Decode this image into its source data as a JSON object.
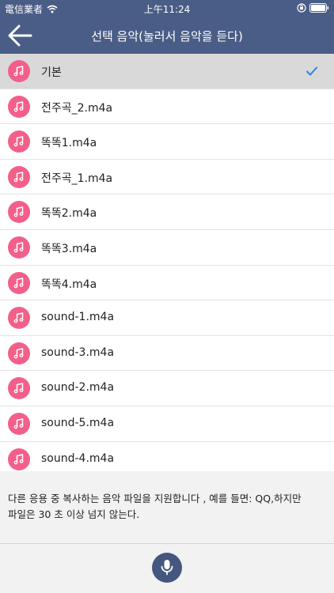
{
  "status_bar": {
    "carrier": "電信業者",
    "time": "上午11:24"
  },
  "nav": {
    "title": "선택 음악(눌러서 음악을 듣다)"
  },
  "sounds": [
    {
      "label": "기본",
      "selected": true
    },
    {
      "label": "전주곡_2.m4a",
      "selected": false
    },
    {
      "label": "똑똑1.m4a",
      "selected": false
    },
    {
      "label": "전주곡_1.m4a",
      "selected": false
    },
    {
      "label": "똑똑2.m4a",
      "selected": false
    },
    {
      "label": "똑똑3.m4a",
      "selected": false
    },
    {
      "label": "똑똑4.m4a",
      "selected": false
    },
    {
      "label": "sound-1.m4a",
      "selected": false
    },
    {
      "label": "sound-3.m4a",
      "selected": false
    },
    {
      "label": "sound-2.m4a",
      "selected": false
    },
    {
      "label": "sound-5.m4a",
      "selected": false
    },
    {
      "label": "sound-4.m4a",
      "selected": false
    }
  ],
  "info": {
    "line1": "다른 응용 중 복사하는 음악 파일을 지원합니다 , 예를 들면: QQ,하지만",
    "line2": "파일은 30 초 이상 넘지 않는다."
  },
  "colors": {
    "header": "#4a5d86",
    "icon_bg": "#f2608a",
    "check": "#2f80e8",
    "mic_bg": "#45577e"
  },
  "icons": {
    "back": "arrow-left-icon",
    "item": "music-note-icon",
    "selected": "checkmark-icon",
    "record": "microphone-icon"
  }
}
